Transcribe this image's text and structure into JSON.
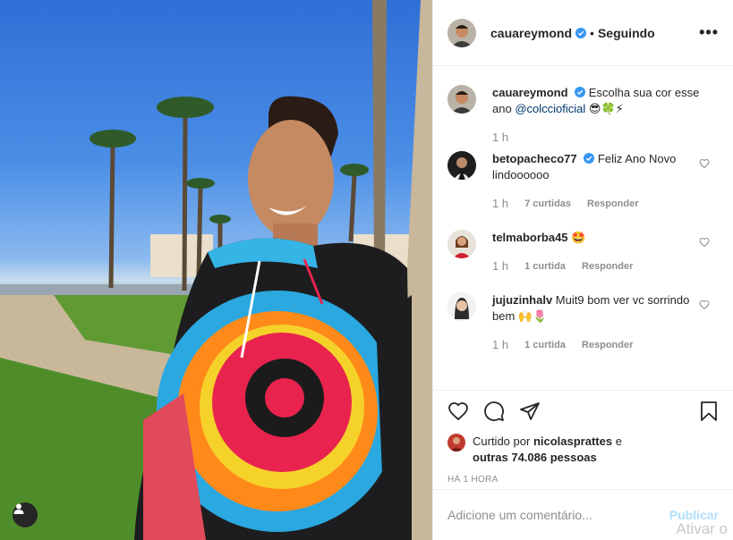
{
  "post": {
    "username": "cauareymond",
    "follow_status": "Seguindo",
    "separator": "•",
    "more_label": "•••",
    "caption": {
      "text_before": "Escolha sua cor esse ano",
      "mention": "@colccioficial",
      "emojis": "😎🍀⚡",
      "time": "1 h"
    },
    "comments": [
      {
        "username": "betopacheco77",
        "verified": true,
        "text": "Feliz Ano Novo lindoooooo",
        "time": "1 h",
        "likes": "7 curtidas",
        "reply": "Responder"
      },
      {
        "username": "telmaborba45",
        "verified": false,
        "text": "🤩",
        "time": "1 h",
        "likes": "1 curtida",
        "reply": "Responder"
      },
      {
        "username": "jujuzinhalv",
        "verified": false,
        "text": "Muit9 bom ver vc sorrindo bem 🙌🌷",
        "time": "1 h",
        "likes": "1 curtida",
        "reply": "Responder"
      }
    ],
    "liked_by_prefix": "Curtido por",
    "liked_by_user": "nicolasprattes",
    "liked_by_and": "e",
    "liked_by_others": "outras 74.086 pessoas",
    "post_time": "HÁ 1 HORA",
    "comment_placeholder": "Adicione um comentário...",
    "publish_label": "Publicar"
  },
  "icons": {
    "verified": "verified-badge-icon",
    "like": "heart-icon",
    "comment": "comment-bubble-icon",
    "share": "paper-plane-icon",
    "save": "bookmark-icon",
    "more": "ellipsis-icon",
    "tag": "user-tag-icon"
  },
  "colors": {
    "verified": "#3897f0",
    "link": "#00376b",
    "muted": "#8e8e8e",
    "publish_disabled": "#b2dffc",
    "text": "#262626"
  },
  "watermark": "Ativar o"
}
